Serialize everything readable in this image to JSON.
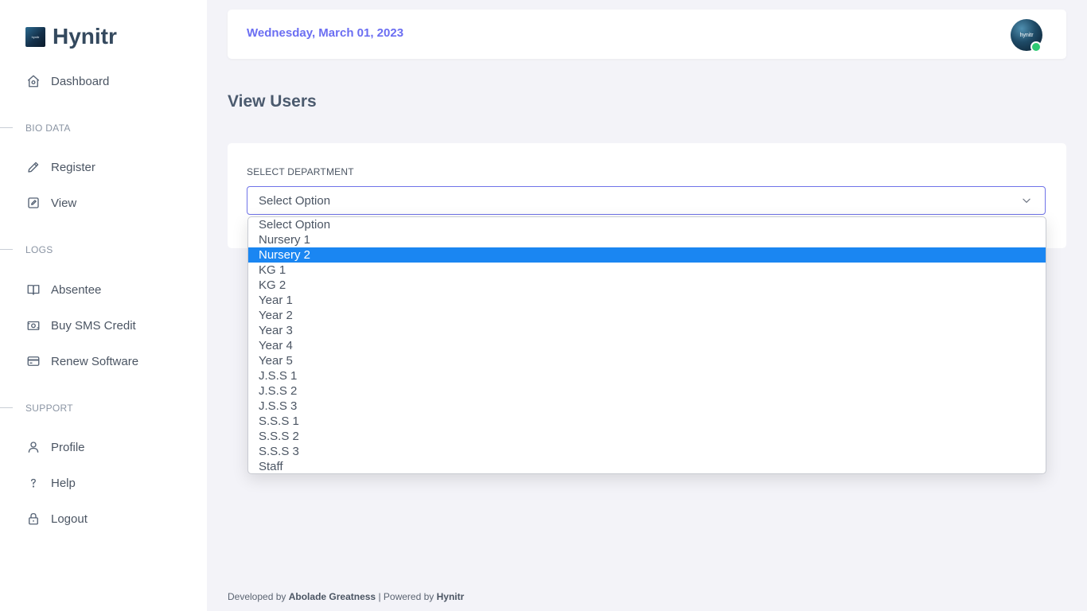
{
  "brand": {
    "name": "Hynitr",
    "logo_text": "hynitr"
  },
  "sidebar": {
    "dashboard": "Dashboard",
    "sections": {
      "bio_data": "BIO DATA",
      "logs": "LOGS",
      "support": "SUPPORT"
    },
    "items": {
      "register": "Register",
      "view": "View",
      "absentee": "Absentee",
      "buy_sms": "Buy SMS Credit",
      "renew": "Renew Software",
      "profile": "Profile",
      "help": "Help",
      "logout": "Logout"
    }
  },
  "header": {
    "date": "Wednesday, March 01, 2023",
    "avatar_text": "hynitr",
    "status_color": "#2ec973"
  },
  "page": {
    "title": "View Users"
  },
  "form": {
    "label": "SELECT DEPARTMENT",
    "selected_value": "Select Option",
    "options": [
      "Select Option",
      "Nursery 1",
      "Nursery 2",
      "KG 1",
      "KG 2",
      "Year 1",
      "Year 2",
      "Year 3",
      "Year 4",
      "Year 5",
      "J.S.S 1",
      "J.S.S 2",
      "J.S.S 3",
      "S.S.S 1",
      "S.S.S 2",
      "S.S.S 3",
      "Staff"
    ],
    "highlighted_option": "Nursery 2"
  },
  "footer": {
    "developed_by": "Developed by",
    "developer": "Abolade Greatness",
    "separator": "| Powered by",
    "powered": "Hynitr"
  },
  "colors": {
    "accent": "#6b6ef2",
    "highlight": "#1a86f2",
    "background": "#f3f3f8"
  }
}
